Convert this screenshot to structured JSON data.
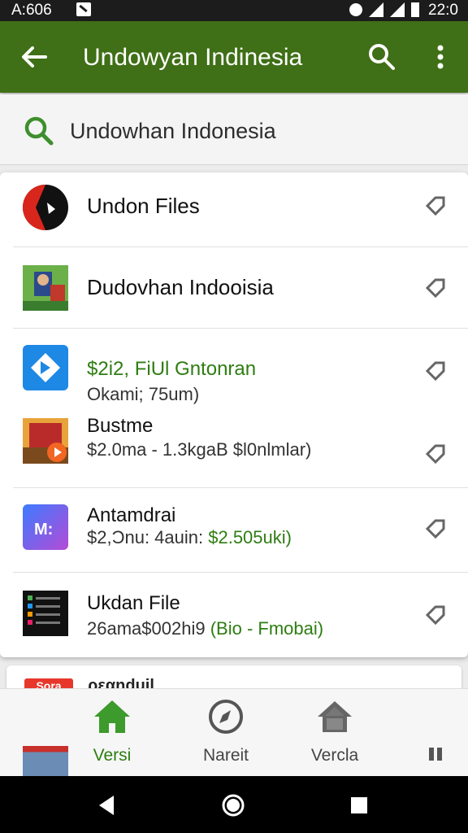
{
  "status_bar": {
    "time": "A:606",
    "clock": "22:0"
  },
  "toolbar": {
    "title": "Undowyan Indinesia"
  },
  "search": {
    "query": "Undowhan Indonesia"
  },
  "results": [
    {
      "title": "Undon Files",
      "subtitle": null,
      "price": null
    },
    {
      "title": "Dudovhan Indooisia",
      "subtitle": null,
      "price": null
    },
    {
      "title_price": "$2i2, FiUl Gntonran",
      "subtitle": "Okami; 75um)"
    },
    {
      "title": "Bustme",
      "subtitle": "$2.0ma - 1.3kgaB $l0nlmlar)"
    },
    {
      "title": "Antamdrai",
      "subtitle": "$2,Ɔnu: 4auin:",
      "price": "$2.505uki)"
    },
    {
      "title": "Ukdan File",
      "subtitle": "26ama$002hi9",
      "price": "(Bio - Fmobai)"
    }
  ],
  "peek_item": {
    "title": "ρεαndujl",
    "icon_text": "Şora"
  },
  "bottom_nav": [
    {
      "label": "Versi",
      "icon": "home-icon",
      "active": true
    },
    {
      "label": "Nareit",
      "icon": "compass-icon",
      "active": false
    },
    {
      "label": "Vercla",
      "icon": "home-outline-icon",
      "active": false
    }
  ],
  "colors": {
    "toolbar": "#3f6f16",
    "accent": "#2e7d12",
    "status_bar": "#1c1c1c"
  }
}
